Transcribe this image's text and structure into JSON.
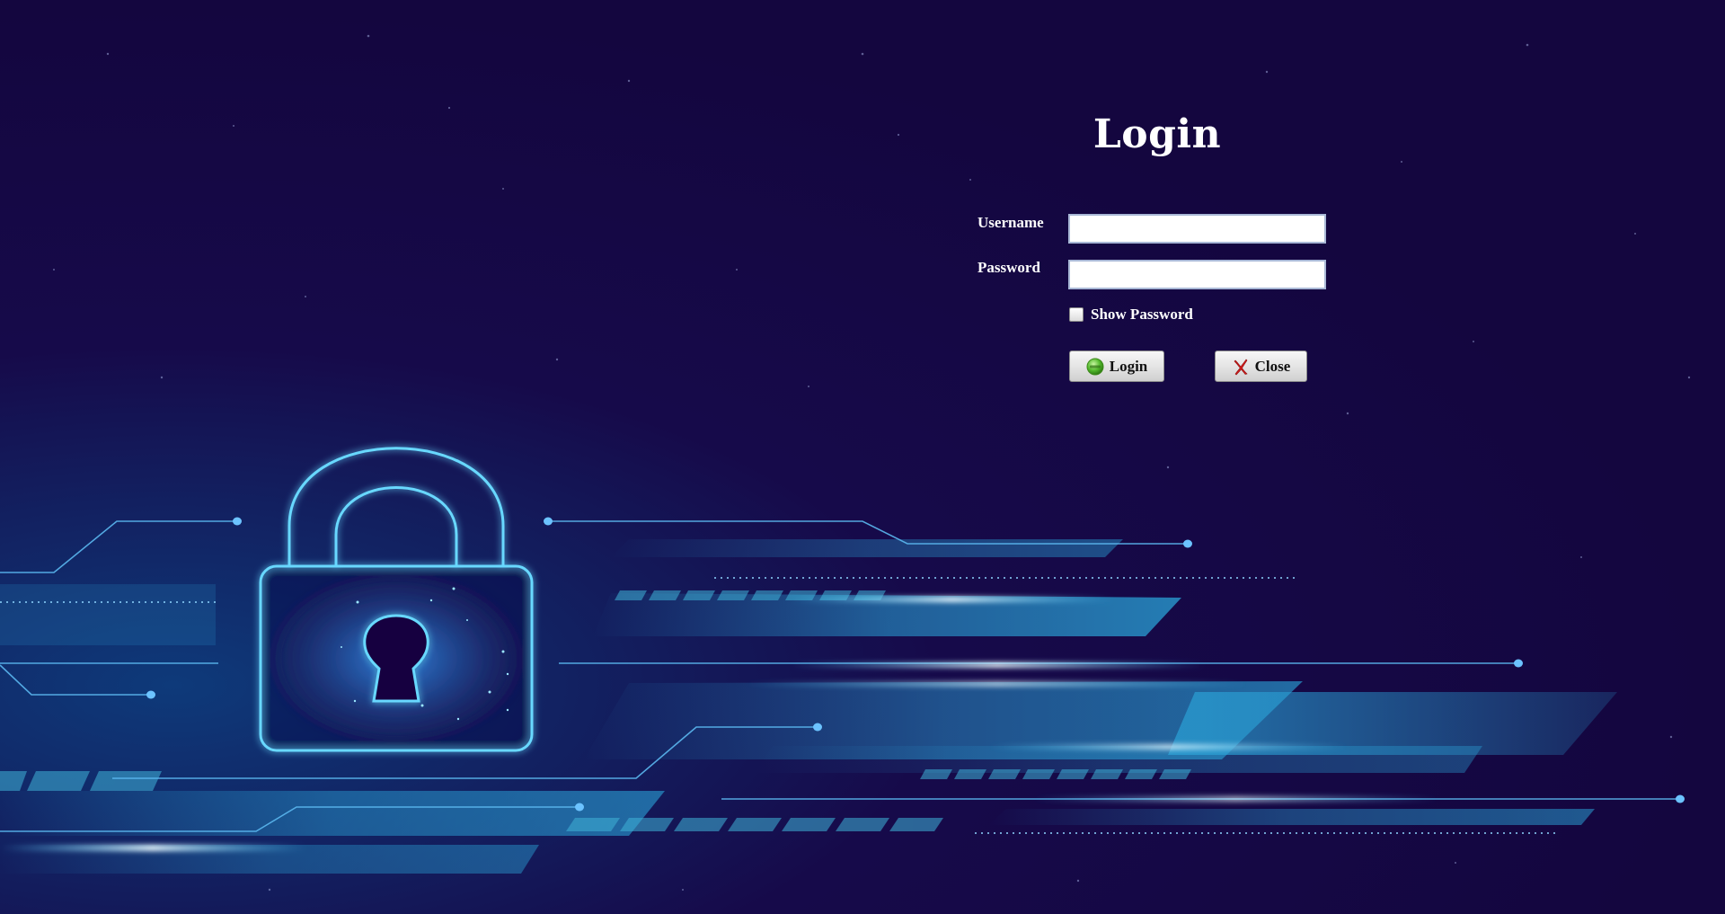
{
  "form": {
    "title": "Login",
    "username_label": "Username",
    "username_value": "",
    "password_label": "Password",
    "password_value": "",
    "show_password_label": "Show Password",
    "show_password_checked": false,
    "login_button_label": "Login",
    "login_icon": "green-circle-icon",
    "close_button_label": "Close",
    "close_icon": "red-x-icon"
  },
  "background": {
    "illustration": "padlock-icon",
    "colors": {
      "base": "#14063f",
      "accent": "#4fd0ff",
      "glow": "#2a7fd6"
    }
  }
}
